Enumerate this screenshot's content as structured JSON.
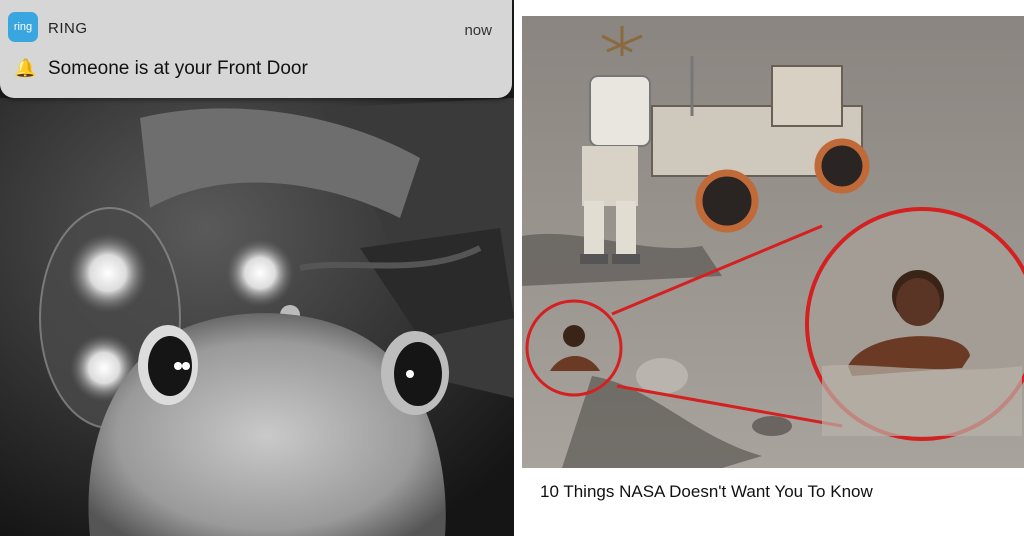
{
  "notification": {
    "app_icon_text": "ring",
    "app_name": "RING",
    "time": "now",
    "message": "Someone is at your Front Door",
    "icon": "bell-icon"
  },
  "right_panel": {
    "caption": "10 Things NASA Doesn't Want You To Know"
  },
  "colors": {
    "ring_accent": "#3aa6e0",
    "highlight_circle": "#d42020"
  }
}
